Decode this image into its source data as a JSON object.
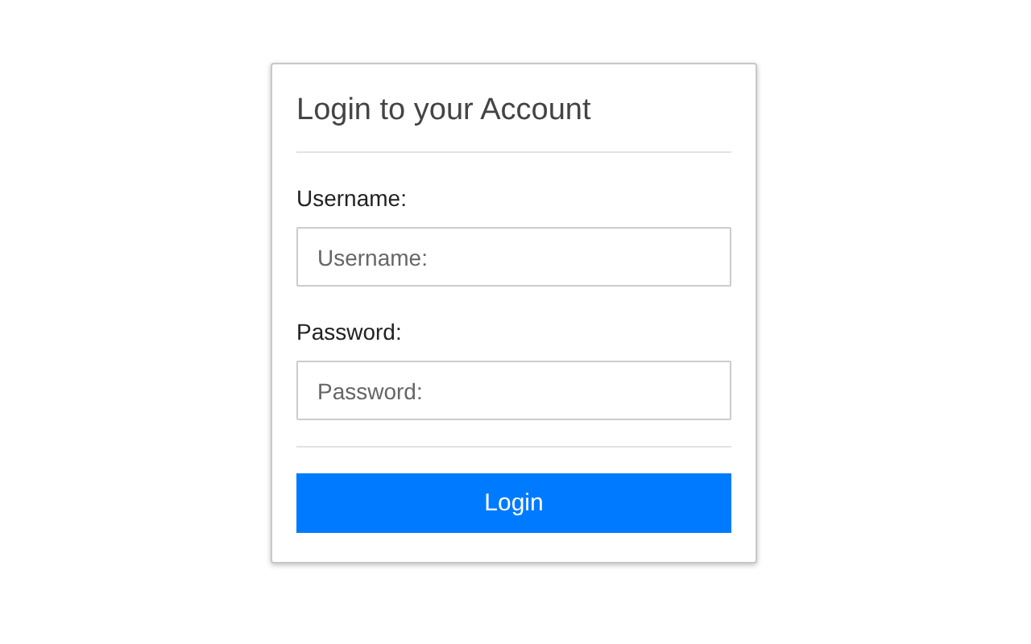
{
  "card": {
    "title": "Login to your Account"
  },
  "fields": [
    {
      "label": "Username:",
      "placeholder": "Username:"
    },
    {
      "label": "Password:",
      "placeholder": "Password:"
    }
  ],
  "button": {
    "label": "Login"
  }
}
